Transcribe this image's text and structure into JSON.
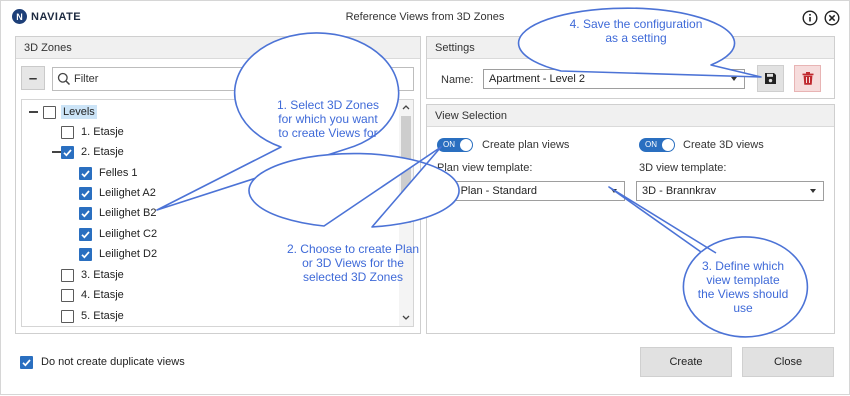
{
  "app": {
    "brand": "NAVIATE",
    "window_title": "Reference Views from 3D Zones"
  },
  "zones": {
    "title": "3D Zones",
    "filter_placeholder": "Filter",
    "tree": [
      {
        "label": "Levels",
        "checked": false
      },
      {
        "label": "1. Etasje",
        "checked": false
      },
      {
        "label": "2. Etasje",
        "checked": true
      },
      {
        "label": "Felles 1",
        "checked": true
      },
      {
        "label": "Leilighet A2",
        "checked": true
      },
      {
        "label": "Leilighet B2",
        "checked": true
      },
      {
        "label": "Leilighet C2",
        "checked": true
      },
      {
        "label": "Leilighet D2",
        "checked": true
      },
      {
        "label": "3. Etasje",
        "checked": false
      },
      {
        "label": "4. Etasje",
        "checked": false
      },
      {
        "label": "5. Etasje",
        "checked": false
      }
    ]
  },
  "settings": {
    "title": "Settings",
    "name_label": "Name:",
    "name_value": "Apartment - Level 2"
  },
  "view_selection": {
    "title": "View Selection",
    "toggle_on": "ON",
    "create_plan": "Create plan views",
    "create_3d": "Create 3D views",
    "plan_template_label": "Plan view template:",
    "plan_template_value": "A1. Plan - Standard",
    "template_3d_label": "3D view template:",
    "template_3d_value": "3D - Brannkrav"
  },
  "footer": {
    "no_duplicates": "Do not create duplicate views",
    "create": "Create",
    "close": "Close"
  },
  "callouts": [
    {
      "lines": [
        "1. Select 3D Zones",
        "for which you want",
        "to create Views for"
      ]
    },
    {
      "lines": [
        "2. Choose to create Plan",
        "or 3D Views for the",
        "selected 3D Zones"
      ]
    },
    {
      "lines": [
        "3. Define which",
        "view template",
        "the Views should",
        "use"
      ]
    },
    {
      "lines": [
        "4. Save the configuration",
        "as a setting"
      ]
    }
  ],
  "colors": {
    "accent": "#2a6fc0",
    "danger": "#c0282e",
    "callout_text": "#3f6ad8",
    "callout_stroke": "#4c73d6"
  }
}
